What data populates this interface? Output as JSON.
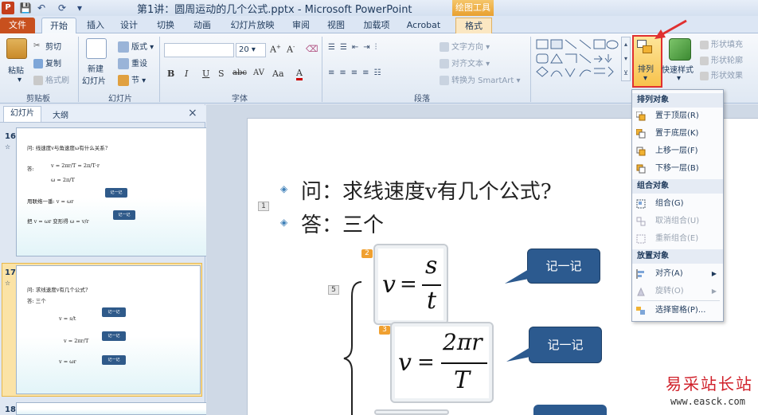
{
  "window": {
    "title": "第1讲：圆周运动的几个公式.pptx - Microsoft PowerPoint",
    "app_icon": "P",
    "context_tab_label": "绘图工具"
  },
  "tabs": [
    {
      "label": "文件"
    },
    {
      "label": "开始"
    },
    {
      "label": "插入"
    },
    {
      "label": "设计"
    },
    {
      "label": "切换"
    },
    {
      "label": "动画"
    },
    {
      "label": "幻灯片放映"
    },
    {
      "label": "审阅"
    },
    {
      "label": "视图"
    },
    {
      "label": "加载项"
    },
    {
      "label": "Acrobat"
    },
    {
      "label": "格式"
    }
  ],
  "ribbon": {
    "clipboard": {
      "paste": "粘贴",
      "cut": "剪切",
      "copy": "复制",
      "format_painter": "格式刷",
      "label": "剪贴板"
    },
    "slides": {
      "new_slide_1": "新建",
      "new_slide_2": "幻灯片",
      "layout": "版式",
      "reset": "重设",
      "section": "节",
      "label": "幻灯片"
    },
    "font": {
      "size": "20",
      "label": "字体",
      "bold": "B",
      "italic": "I",
      "underline": "U",
      "shadow": "S",
      "strike": "abc",
      "spacing": "AV",
      "case": "Aa",
      "color": "A"
    },
    "paragraph": {
      "text_direction": "文字方向",
      "align_text": "对齐文本",
      "convert_smartart": "转换为 SmartArt",
      "label": "段落"
    },
    "drawing": {
      "arrange": "排列",
      "quick_styles": "快速样式",
      "shape_fill": "形状填充",
      "shape_outline": "形状轮廓",
      "shape_effects": "形状效果"
    }
  },
  "pane": {
    "tab_slides": "幻灯片",
    "tab_outline": "大纲",
    "close": "×",
    "slides": [
      {
        "number": "16",
        "marker": "☆",
        "line1": "问: 线速度v与角速度ω有什么关系?",
        "line2": "答:",
        "line3": "v = 2πr/T = 2π/T·r",
        "line4": "ω = 2π/T",
        "line5": "用联络一番: v = ωr",
        "line6": "把 v = ωr 变形得 ω = v/r",
        "callout": "记一记"
      },
      {
        "number": "17",
        "marker": "☆",
        "line1": "问: 求线速度v有几个公式?",
        "line2": "答: 三个",
        "f1": "v = s/t",
        "f2": "v = 2πr/T",
        "f3": "v = ωr",
        "callout": "记一记"
      },
      {
        "number": "18"
      }
    ]
  },
  "slide": {
    "question": "问：求线速度v有几个公式?",
    "answer": "答：三个",
    "tag_question": "1",
    "tag_brace": "5",
    "tag_formula1": "2",
    "tag_formula2": "3",
    "formula1": {
      "lhs": "v",
      "eq": "=",
      "num": "s",
      "den": "t"
    },
    "formula2": {
      "lhs": "v",
      "eq": "=",
      "num": "2πr",
      "den": "T"
    },
    "callout1": "记一记",
    "callout2": "记一记"
  },
  "arrange_menu": {
    "section_order": "排列对象",
    "bring_to_front": "置于顶层(R)",
    "send_to_back": "置于底层(K)",
    "bring_forward": "上移一层(F)",
    "send_backward": "下移一层(B)",
    "section_group": "组合对象",
    "group": "组合(G)",
    "ungroup": "取消组合(U)",
    "regroup": "重新组合(E)",
    "section_position": "放置对象",
    "align": "对齐(A)",
    "rotate": "旋转(O)",
    "selection_pane": "选择窗格(P)..."
  },
  "watermark": {
    "line1": "易采站长站",
    "line2": "www.easck.com"
  },
  "colors": {
    "file_tab": "#c8501e",
    "callout": "#2c5a8f",
    "highlight_border": "#e03030",
    "arrow": "#e03030"
  }
}
